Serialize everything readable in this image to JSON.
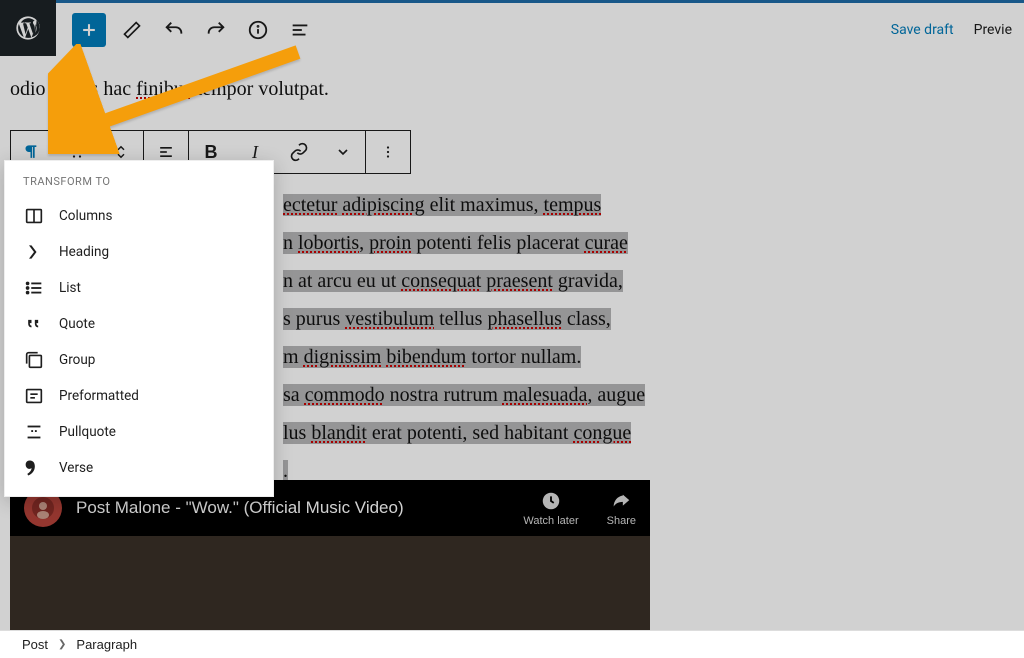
{
  "topbar": {
    "save_draft": "Save draft",
    "preview": "Previe"
  },
  "intro_text": "odio luctus hac finibus tempor volutpat.",
  "block_toolbar": {
    "bold": "B",
    "italic": "I"
  },
  "dropdown": {
    "title": "TRANSFORM TO",
    "items": [
      {
        "icon": "columns",
        "label": "Columns"
      },
      {
        "icon": "heading",
        "label": "Heading"
      },
      {
        "icon": "list",
        "label": "List"
      },
      {
        "icon": "quote",
        "label": "Quote"
      },
      {
        "icon": "group",
        "label": "Group"
      },
      {
        "icon": "preformatted",
        "label": "Preformatted"
      },
      {
        "icon": "pullquote",
        "label": "Pullquote"
      },
      {
        "icon": "verse",
        "label": "Verse"
      }
    ]
  },
  "paragraph_lines": [
    "ectetur adipiscing elit maximus, tempus",
    "n lobortis, proin potenti felis placerat curae",
    "n at arcu eu ut consequat praesent gravida,",
    "s purus vestibulum tellus phasellus class,",
    "m dignissim bibendum tortor nullam.",
    "sa commodo nostra rutrum malesuada, augue",
    "lus blandit erat potenti, sed habitant congue",
    "."
  ],
  "video": {
    "title": "Post Malone - \"Wow.\" (Official Music Video)",
    "watch_later": "Watch later",
    "share": "Share"
  },
  "breadcrumb": {
    "root": "Post",
    "current": "Paragraph"
  }
}
